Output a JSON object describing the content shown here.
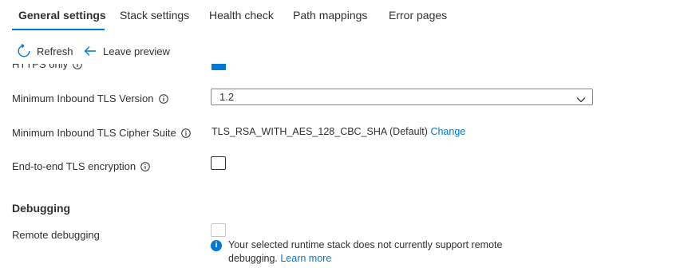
{
  "tabs": [
    {
      "label": "General settings",
      "active": true
    },
    {
      "label": "Stack settings"
    },
    {
      "label": "Health check"
    },
    {
      "label": "Path mappings"
    },
    {
      "label": "Error pages"
    }
  ],
  "toolbar": {
    "refresh_label": "Refresh",
    "leave_preview_label": "Leave preview"
  },
  "settings": {
    "https_only_label": "HTTPS only",
    "min_tls_label": "Minimum Inbound TLS Version",
    "min_tls_value": "1.2",
    "cipher_label": "Minimum Inbound TLS Cipher Suite",
    "cipher_value": "TLS_RSA_WITH_AES_128_CBC_SHA (Default)",
    "cipher_change": "Change",
    "e2e_label": "End-to-end TLS encryption"
  },
  "debugging": {
    "heading": "Debugging",
    "remote_label": "Remote debugging",
    "info_text": "Your selected runtime stack does not currently support remote debugging.",
    "info_link": "Learn more"
  },
  "colors": {
    "accent": "#0078d4",
    "text": "#323130"
  }
}
